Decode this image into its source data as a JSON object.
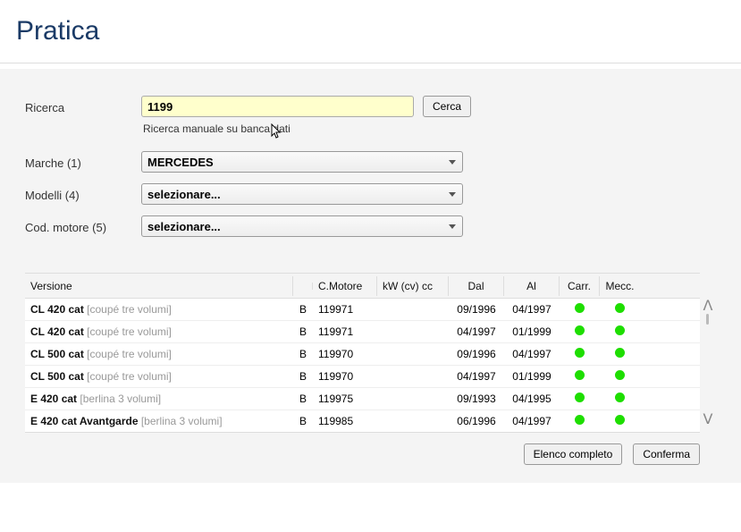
{
  "page": {
    "title": "Pratica"
  },
  "search": {
    "label": "Ricerca",
    "value": "1199",
    "btn": "Cerca",
    "hint": "Ricerca manuale su banca dati"
  },
  "brands": {
    "label": "Marche (1)",
    "selected": "MERCEDES"
  },
  "models": {
    "label": "Modelli (4)",
    "selected": "selezionare..."
  },
  "engines": {
    "label": "Cod. motore (5)",
    "selected": "selezionare..."
  },
  "table": {
    "headers": {
      "version": "Versione",
      "engineCode": "C.Motore",
      "kwcv": "kW (cv) cc",
      "from": "Dal",
      "to": "Al",
      "carr": "Carr.",
      "mecc": "Mecc."
    },
    "rows": [
      {
        "name": "CL 420 cat",
        "body": "[coupé tre volumi]",
        "t": "B",
        "engine": "119971",
        "kw": "",
        "from": "09/1996",
        "to": "04/1997",
        "carr": true,
        "mecc": true
      },
      {
        "name": "CL 420 cat",
        "body": "[coupé tre volumi]",
        "t": "B",
        "engine": "119971",
        "kw": "",
        "from": "04/1997",
        "to": "01/1999",
        "carr": true,
        "mecc": true
      },
      {
        "name": "CL 500 cat",
        "body": "[coupé tre volumi]",
        "t": "B",
        "engine": "119970",
        "kw": "",
        "from": "09/1996",
        "to": "04/1997",
        "carr": true,
        "mecc": true
      },
      {
        "name": "CL 500 cat",
        "body": "[coupé tre volumi]",
        "t": "B",
        "engine": "119970",
        "kw": "",
        "from": "04/1997",
        "to": "01/1999",
        "carr": true,
        "mecc": true
      },
      {
        "name": "E 420 cat",
        "body": "[berlina 3 volumi]",
        "t": "B",
        "engine": "119975",
        "kw": "",
        "from": "09/1993",
        "to": "04/1995",
        "carr": true,
        "mecc": true
      },
      {
        "name": "E 420 cat Avantgarde",
        "body": "[berlina 3 volumi]",
        "t": "B",
        "engine": "119985",
        "kw": "",
        "from": "06/1996",
        "to": "04/1997",
        "carr": true,
        "mecc": true
      }
    ]
  },
  "footer": {
    "fullList": "Elenco completo",
    "confirm": "Conferma"
  }
}
